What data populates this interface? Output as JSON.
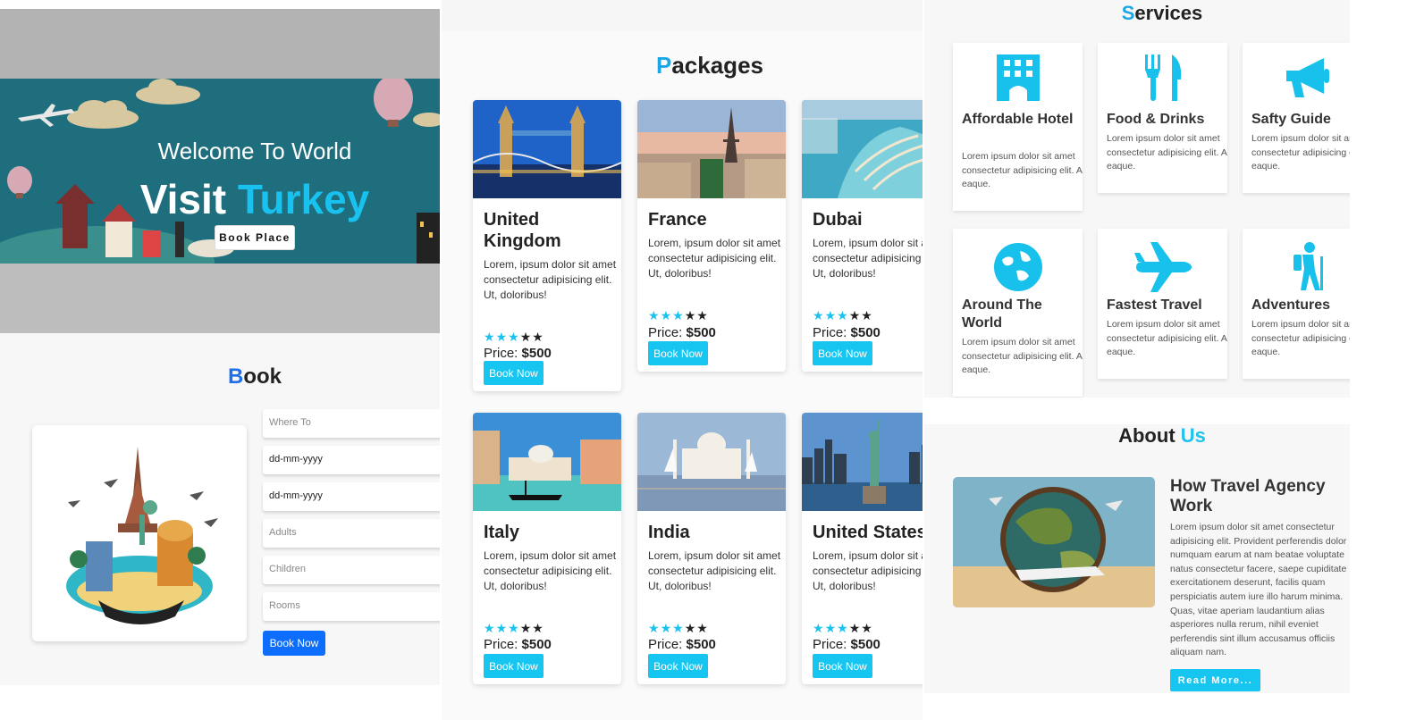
{
  "hero": {
    "welcome": "Welcome To World",
    "visit": "Visit",
    "destination": "Turkey",
    "button": "Book Place"
  },
  "book": {
    "title_first": "B",
    "title_rest": "ook",
    "fields": [
      {
        "placeholder": "Where To",
        "style": "placeholder"
      },
      {
        "placeholder": "dd-mm-yyyy",
        "style": "value"
      },
      {
        "placeholder": "dd-mm-yyyy",
        "style": "value"
      },
      {
        "placeholder": "Adults",
        "style": "placeholder"
      },
      {
        "placeholder": "Children",
        "style": "placeholder"
      },
      {
        "placeholder": "Rooms",
        "style": "placeholder"
      }
    ],
    "submit": "Book Now"
  },
  "packages": {
    "title_first": "P",
    "title_rest": "ackages",
    "price_label": "Price: ",
    "button": "Book Now",
    "items": [
      {
        "name": "United Kingdom",
        "desc": "Lorem, ipsum dolor sit amet consectetur adipisicing elit. Ut, doloribus!",
        "rating": 3,
        "max": 5,
        "price": "$500"
      },
      {
        "name": "France",
        "desc": "Lorem, ipsum dolor sit amet consectetur adipisicing elit. Ut, doloribus!",
        "rating": 3,
        "max": 5,
        "price": "$500"
      },
      {
        "name": "Dubai",
        "desc": "Lorem, ipsum dolor sit amet consectetur adipisicing elit. Ut, doloribus!",
        "rating": 3,
        "max": 5,
        "price": "$500"
      },
      {
        "name": "Italy",
        "desc": "Lorem, ipsum dolor sit amet consectetur adipisicing elit. Ut, doloribus!",
        "rating": 3,
        "max": 5,
        "price": "$500"
      },
      {
        "name": "India",
        "desc": "Lorem, ipsum dolor sit amet consectetur adipisicing elit. Ut, doloribus!",
        "rating": 3,
        "max": 5,
        "price": "$500"
      },
      {
        "name": "United States",
        "desc": "Lorem, ipsum dolor sit amet consectetur adipisicing elit. Ut, doloribus!",
        "rating": 3,
        "max": 5,
        "price": "$500"
      }
    ]
  },
  "services": {
    "title_first": "S",
    "title_rest": "ervices",
    "items": [
      {
        "name": "Affordable Hotel",
        "icon": "hotel-icon",
        "desc": "Lorem ipsum dolor sit amet consectetur adipisicing elit. A, eaque."
      },
      {
        "name": "Food & Drinks",
        "icon": "utensils-icon",
        "desc": "Lorem ipsum dolor sit amet consectetur adipisicing elit. A, eaque."
      },
      {
        "name": "Safty Guide",
        "icon": "megaphone-icon",
        "desc": "Lorem ipsum dolor sit amet consectetur adipisicing elit. A, eaque."
      },
      {
        "name": "Around The World",
        "icon": "globe-icon",
        "desc": "Lorem ipsum dolor sit amet consectetur adipisicing elit. A, eaque."
      },
      {
        "name": "Fastest Travel",
        "icon": "plane-icon",
        "desc": "Lorem ipsum dolor sit amet consectetur adipisicing elit. A, eaque."
      },
      {
        "name": "Adventures",
        "icon": "hiker-icon",
        "desc": "Lorem ipsum dolor sit amet consectetur adipisicing elit. A, eaque."
      }
    ]
  },
  "about": {
    "title_first": "About ",
    "title_accent": "Us",
    "heading": "How Travel Agency Work",
    "text": "Lorem ipsum dolor sit amet consectetur adipisicing elit. Provident perferendis dolor numquam earum at nam beatae voluptate natus consectetur facere, saepe cupiditate exercitationem deserunt, facilis quam perspiciatis autem iure illo harum minima. Quas, vitae aperiam laudantium alias asperiores nulla rerum, nihil eveniet perferendis sint illum accusamus officiis aliquam nam.",
    "button": "Read More..."
  },
  "colors": {
    "accent": "#19c1ee",
    "book_blue": "#0d6efd",
    "hero_teal": "#1f6e7d"
  }
}
